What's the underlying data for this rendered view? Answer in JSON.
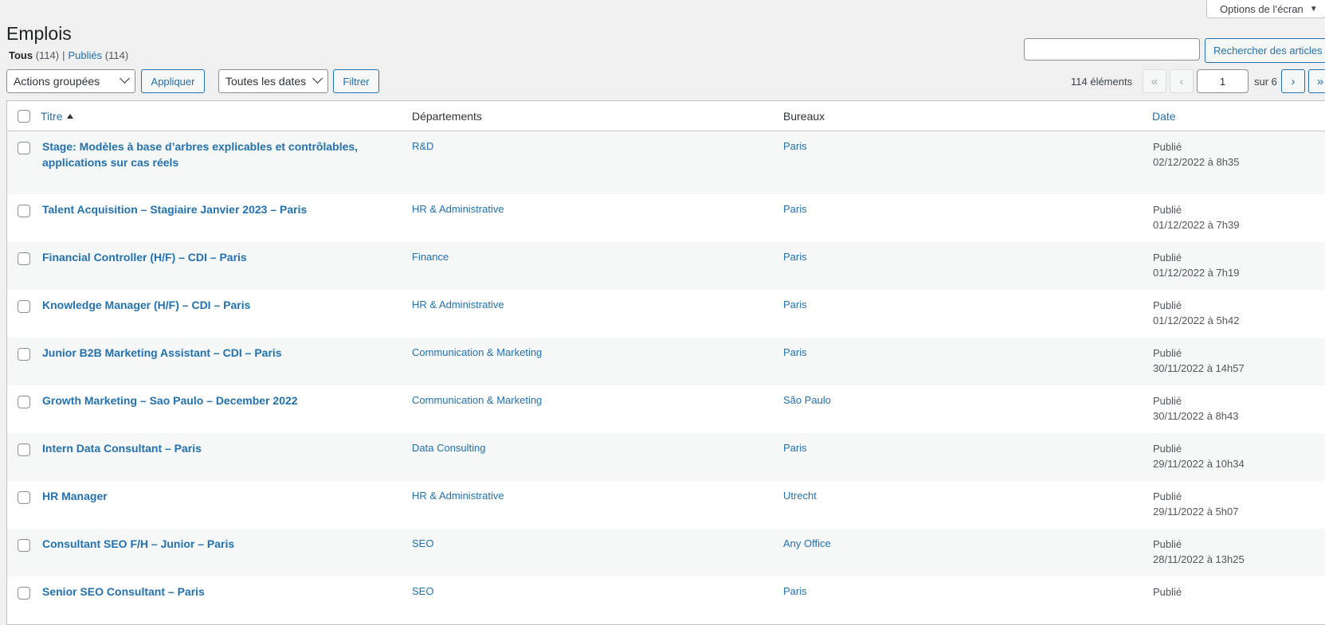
{
  "page": {
    "title": "Emplois",
    "screen_options": "Options de l’écran"
  },
  "views": {
    "all_label": "Tous",
    "all_count": "(114)",
    "published_label": "Publiés",
    "published_count": "(114)",
    "separator": "|"
  },
  "search": {
    "value": "",
    "button": "Rechercher des articles"
  },
  "toolbar": {
    "bulk_actions": "Actions groupées",
    "apply": "Appliquer",
    "dates": "Toutes les dates",
    "filter": "Filtrer"
  },
  "pagination": {
    "items": "114 éléments",
    "first": "«",
    "prev": "‹",
    "current_page": "1",
    "total": "sur 6",
    "next": "›",
    "last": "»"
  },
  "columns": {
    "title": "Titre",
    "departments": "Départements",
    "offices": "Bureaux",
    "date": "Date"
  },
  "rows": [
    {
      "title": "Stage: Modèles à base d’arbres explicables et contrôlables, applications sur cas réels",
      "department": "R&D",
      "office": "Paris",
      "status": "Publié",
      "date": "02/12/2022 à 8h35"
    },
    {
      "title": "Talent Acquisition – Stagiaire Janvier 2023 – Paris",
      "department": "HR & Administrative",
      "office": "Paris",
      "status": "Publié",
      "date": "01/12/2022 à 7h39"
    },
    {
      "title": "Financial Controller (H/F) – CDI – Paris",
      "department": "Finance",
      "office": "Paris",
      "status": "Publié",
      "date": "01/12/2022 à 7h19"
    },
    {
      "title": "Knowledge Manager (H/F) – CDI – Paris",
      "department": "HR & Administrative",
      "office": "Paris",
      "status": "Publié",
      "date": "01/12/2022 à 5h42"
    },
    {
      "title": "Junior B2B Marketing Assistant – CDI – Paris",
      "department": "Communication & Marketing",
      "office": "Paris",
      "status": "Publié",
      "date": "30/11/2022 à 14h57"
    },
    {
      "title": "Growth Marketing – Sao Paulo – December 2022",
      "department": "Communication & Marketing",
      "office": "São Paulo",
      "status": "Publié",
      "date": "30/11/2022 à 8h43"
    },
    {
      "title": "Intern Data Consultant – Paris",
      "department": "Data Consulting",
      "office": "Paris",
      "status": "Publié",
      "date": "29/11/2022 à 10h34"
    },
    {
      "title": "HR Manager",
      "department": "HR & Administrative",
      "office": "Utrecht",
      "status": "Publié",
      "date": "29/11/2022 à 5h07"
    },
    {
      "title": "Consultant SEO F/H – Junior – Paris",
      "department": "SEO",
      "office": "Any Office",
      "status": "Publié",
      "date": "28/11/2022 à 13h25"
    },
    {
      "title": "Senior SEO Consultant – Paris",
      "department": "SEO",
      "office": "Paris",
      "status": "Publié",
      "date": ""
    }
  ]
}
